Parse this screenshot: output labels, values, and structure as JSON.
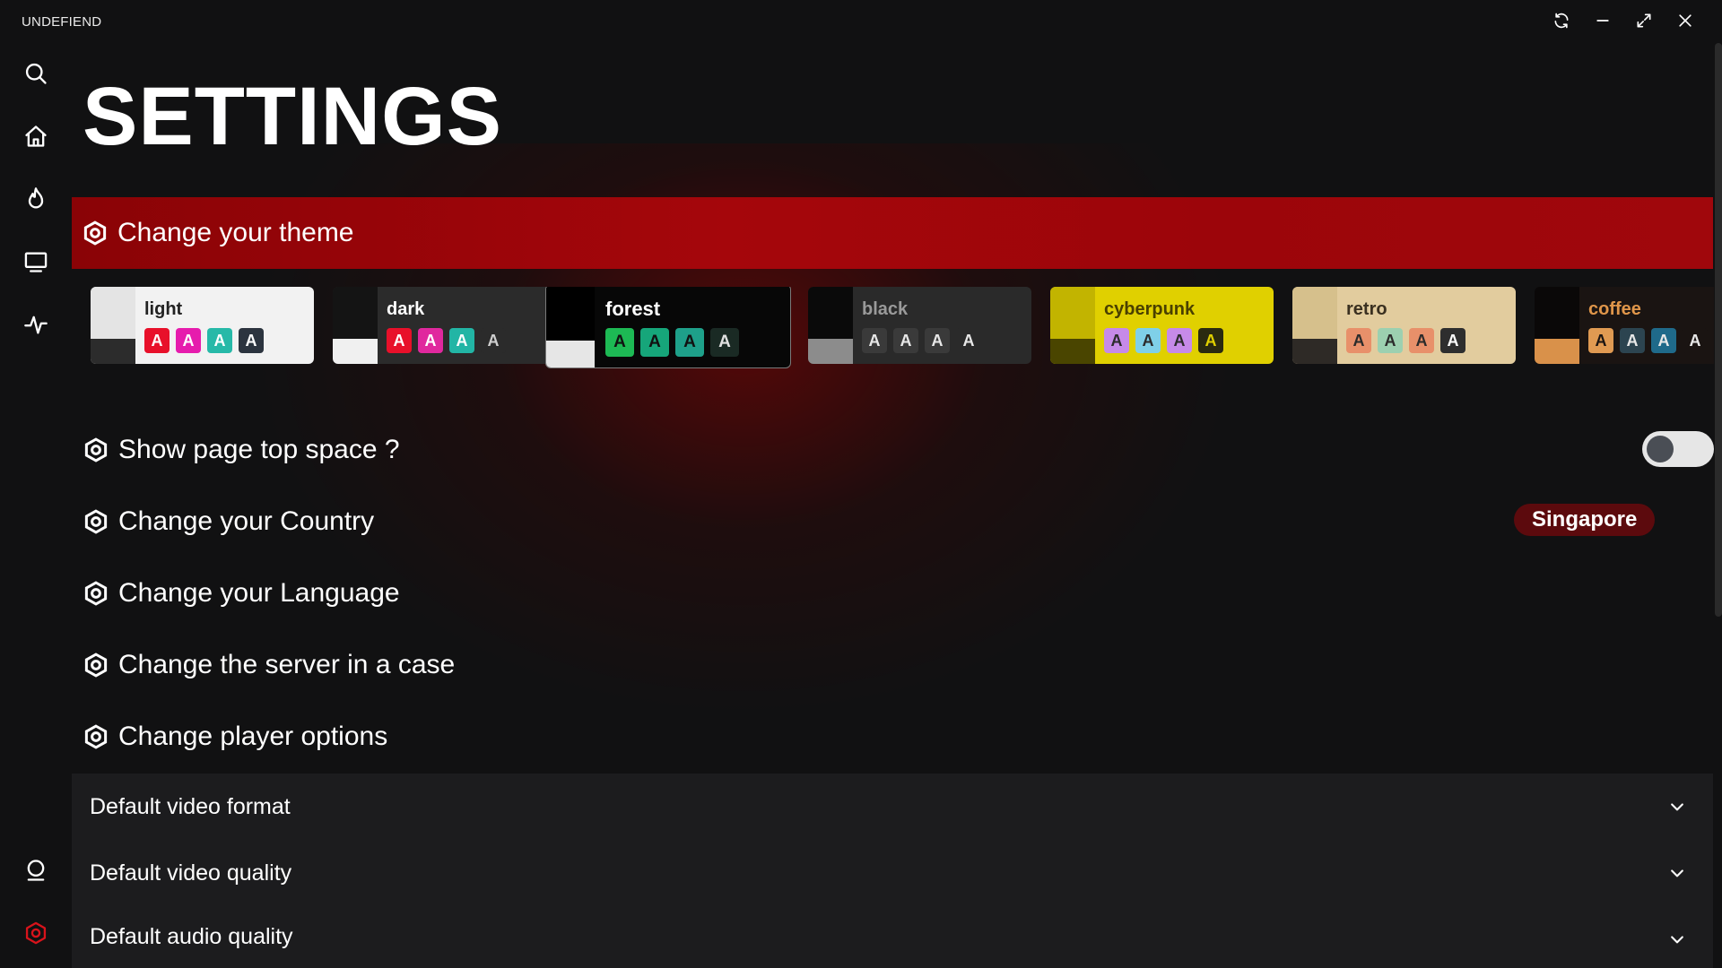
{
  "app": {
    "title": "UNDEFIEND"
  },
  "window_controls": [
    {
      "name": "refresh-icon"
    },
    {
      "name": "minimize-icon"
    },
    {
      "name": "maximize-icon"
    },
    {
      "name": "close-icon"
    }
  ],
  "sidebar": {
    "items": [
      {
        "name": "search-icon"
      },
      {
        "name": "home-icon"
      },
      {
        "name": "fire-icon"
      },
      {
        "name": "tv-icon"
      },
      {
        "name": "activity-icon"
      },
      {
        "name": "user-icon"
      },
      {
        "name": "settings-icon",
        "active": true
      }
    ]
  },
  "page": {
    "title": "SETTINGS"
  },
  "theme_section": {
    "label": "Change your theme"
  },
  "themes": [
    {
      "name": "light",
      "bg": "#f2f2f2",
      "name_color": "#222222",
      "swatch_top": "#e4e4e4",
      "swatch_bottom": "#2c2c2c",
      "chips": [
        {
          "bg": "#e8102a",
          "fg": "#ffffff"
        },
        {
          "bg": "#e61cad",
          "fg": "#ffffff"
        },
        {
          "bg": "#27b9a8",
          "fg": "#ffffff"
        },
        {
          "bg": "#2c343f",
          "fg": "#ffffff"
        }
      ],
      "chip_letter": "A"
    },
    {
      "name": "dark",
      "bg": "#2b2b2b",
      "name_color": "#ffffff",
      "swatch_top": "#141414",
      "swatch_bottom": "#f0f0f0",
      "chips": [
        {
          "bg": "#e8102a",
          "fg": "#ffffff"
        },
        {
          "bg": "#e0289e",
          "fg": "#ffffff"
        },
        {
          "bg": "#22b5a5",
          "fg": "#ffffff"
        },
        {
          "bg": "#2b2b2b",
          "fg": "#cfcfcf"
        }
      ],
      "chip_letter": "A"
    },
    {
      "name": "forest",
      "bg": "#070707",
      "name_color": "#ffffff",
      "swatch_top": "#000000",
      "swatch_bottom": "#e6e6e6",
      "selected": true,
      "chips": [
        {
          "bg": "#1db954",
          "fg": "#111111"
        },
        {
          "bg": "#16a67a",
          "fg": "#111111"
        },
        {
          "bg": "#1ea08a",
          "fg": "#111111"
        },
        {
          "bg": "#1a2a24",
          "fg": "#e0e0e0"
        }
      ],
      "chip_letter": "A"
    },
    {
      "name": "black",
      "bg": "#2a2a2a",
      "name_color": "#9a9a9a",
      "swatch_top": "#0a0a0a",
      "swatch_bottom": "#8c8c8c",
      "chips": [
        {
          "bg": "#3a3a3a",
          "fg": "#e8e8e8"
        },
        {
          "bg": "#3a3a3a",
          "fg": "#e8e8e8"
        },
        {
          "bg": "#3a3a3a",
          "fg": "#e8e8e8"
        },
        {
          "bg": "#2a2a2a",
          "fg": "#e8e8e8"
        }
      ],
      "chip_letter": "A"
    },
    {
      "name": "cyberpunk",
      "bg": "#e0d000",
      "name_color": "#4a4000",
      "swatch_top": "#c2b400",
      "swatch_bottom": "#4a4500",
      "chips": [
        {
          "bg": "#c68ae8",
          "fg": "#2b2b2b"
        },
        {
          "bg": "#7fd0e8",
          "fg": "#2b2b2b"
        },
        {
          "bg": "#c68ae8",
          "fg": "#2b2b2b"
        },
        {
          "bg": "#2a2a10",
          "fg": "#e0d000"
        }
      ],
      "chip_letter": "A"
    },
    {
      "name": "retro",
      "bg": "#e2cc9e",
      "name_color": "#3a3020",
      "swatch_top": "#d6c08c",
      "swatch_bottom": "#2e2a26",
      "chips": [
        {
          "bg": "#e8906a",
          "fg": "#2b2b2b"
        },
        {
          "bg": "#9cd0b0",
          "fg": "#2b2b2b"
        },
        {
          "bg": "#e8906a",
          "fg": "#2b2b2b"
        },
        {
          "bg": "#2e2e2e",
          "fg": "#ffffff"
        }
      ],
      "chip_letter": "A"
    },
    {
      "name": "coffee",
      "bg": "#1a1412",
      "name_color": "#e0964a",
      "swatch_top": "#0a0808",
      "swatch_bottom": "#d9914a",
      "chips": [
        {
          "bg": "#e09a52",
          "fg": "#1a1412"
        },
        {
          "bg": "#2c4450",
          "fg": "#e8e8e8"
        },
        {
          "bg": "#1f6a8a",
          "fg": "#e8e8e8"
        },
        {
          "bg": "#1a1412",
          "fg": "#e8e8e8"
        }
      ],
      "chip_letter": "A"
    }
  ],
  "settings": {
    "top_space": {
      "label": "Show page top space ?",
      "enabled": false
    },
    "country": {
      "label": "Change your Country",
      "value": "Singapore"
    },
    "language": {
      "label": "Change your Language"
    },
    "server": {
      "label": "Change the server in a case"
    },
    "player": {
      "label": "Change player options"
    }
  },
  "player_options": [
    {
      "label": "Default video format"
    },
    {
      "label": "Default video quality"
    },
    {
      "label": "Default audio quality"
    }
  ],
  "colors": {
    "accent": "#d8131b",
    "banner": "#9c050a",
    "background": "#111112",
    "panel": "#1c1c1e"
  }
}
